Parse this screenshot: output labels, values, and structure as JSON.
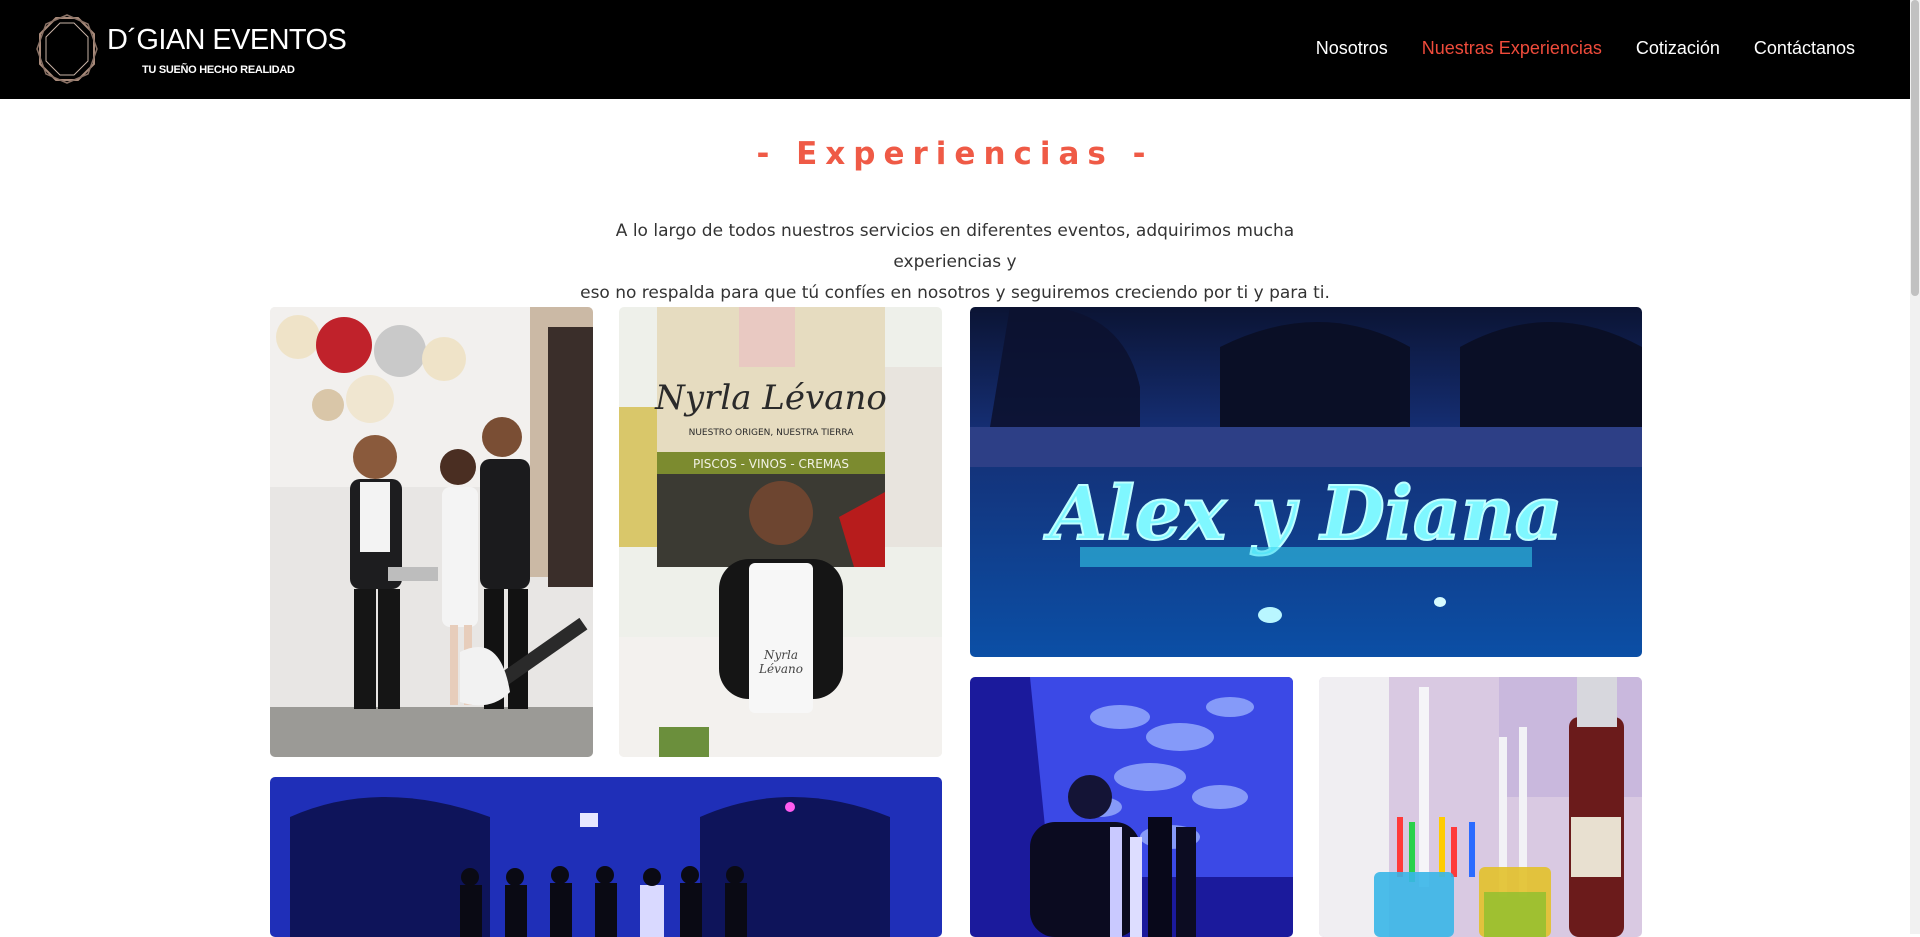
{
  "header": {
    "brand_title": "D´GIAN EVENTOS",
    "brand_tagline": "TU SUEÑO HECHO REALIDAD",
    "nav": [
      {
        "label": "Nosotros"
      },
      {
        "label": "Nuestras Experiencias",
        "active": true
      },
      {
        "label": "Cotización"
      },
      {
        "label": "Contáctanos"
      }
    ]
  },
  "experiences": {
    "title": "- Experiencias -",
    "intro_line1": "A lo largo de todos nuestros servicios en diferentes eventos, adquirimos mucha experiencias y",
    "intro_line2": "eso no respalda para que tú confíes en nosotros y seguiremos creciendo por ti y para ti."
  },
  "gallery": {
    "banner_brand": "Nyrla Lévano",
    "banner_tagline": "NUESTRO ORIGEN, NUESTRA TIERRA",
    "banner_products": "PISCOS - VINOS - CREMAS",
    "apron_text_1": "Nyrla",
    "apron_text_2": "Lévano",
    "pool_sign": "Alex y Diana"
  },
  "colors": {
    "accent": "#ef5a46",
    "nav_active": "#ef4b3b",
    "header_bg": "#000000"
  }
}
